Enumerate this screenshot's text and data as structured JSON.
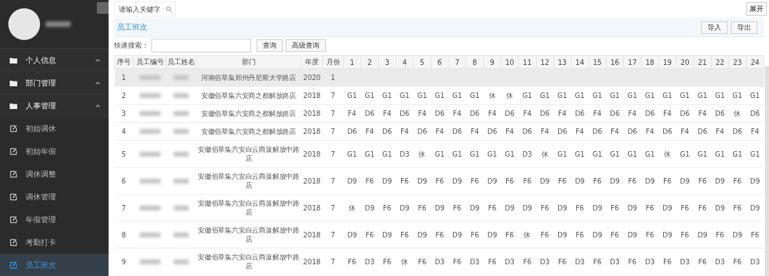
{
  "sidebar": {
    "menu": [
      {
        "label": "个人信息"
      },
      {
        "label": "部门管理"
      },
      {
        "label": "人事管理",
        "children": [
          {
            "label": "初始调休",
            "selected": false
          },
          {
            "label": "初始年假",
            "selected": false
          },
          {
            "label": "调休调整",
            "selected": false
          },
          {
            "label": "调休管理",
            "selected": false
          },
          {
            "label": "年假管理",
            "selected": false
          },
          {
            "label": "考勤打卡",
            "selected": false
          },
          {
            "label": "员工班次",
            "selected": true
          }
        ]
      }
    ]
  },
  "topbar": {
    "search": {
      "placeholder": "请输入关键字"
    },
    "expand_button": "展开"
  },
  "tab": {
    "label": "员工班次"
  },
  "toolbar": {
    "buttons": [
      "导入",
      "导出"
    ]
  },
  "quick_search": {
    "label": "快速搜索：",
    "buttons": [
      "查询",
      "高级查询"
    ]
  },
  "table": {
    "columns": [
      "序号",
      "员工编号",
      "员工姓名",
      "部门",
      "年度",
      "月份",
      "1",
      "2",
      "3",
      "4",
      "5",
      "6",
      "7",
      "8",
      "9",
      "10",
      "11",
      "12",
      "13",
      "14",
      "15",
      "16",
      "17",
      "18",
      "19",
      "20",
      "21",
      "22",
      "23",
      "24"
    ],
    "rows": [
      {
        "index": "1",
        "department": "河南佰草集郑州丹尼斯大学路店",
        "year": "2020",
        "month": "1",
        "selected": true
      },
      {
        "index": "2",
        "department": "安徽佰草集六安商之都解放路店",
        "year": "2018",
        "month": "7",
        "selected": false,
        "shifts": [
          "G1",
          "G1",
          "G1",
          "G1",
          "G1",
          "G1",
          "G1",
          "G1",
          "休",
          "休",
          "G1",
          "G1",
          "G1",
          "G1",
          "G1",
          "G1",
          "G1",
          "G1",
          "G1",
          "G1",
          "G1",
          "G1",
          "G1",
          "G1"
        ]
      },
      {
        "index": "3",
        "department": "安徽佰草集六安商之都解放路店",
        "year": "2018",
        "month": "7",
        "selected": false,
        "shifts": [
          "F4",
          "D6",
          "F4",
          "D6",
          "F4",
          "D6",
          "F4",
          "D6",
          "F4",
          "D6",
          "F4",
          "D6",
          "F4",
          "D6",
          "F4",
          "D6",
          "F4",
          "D6",
          "F4",
          "D6",
          "F4",
          "D6",
          "休",
          "D6"
        ]
      },
      {
        "index": "4",
        "department": "安徽佰草集六安商之都解放路店",
        "year": "2018",
        "month": "7",
        "selected": false,
        "shifts": [
          "D6",
          "F4",
          "D6",
          "F4",
          "D6",
          "F4",
          "D6",
          "F4",
          "D6",
          "F4",
          "D6",
          "F4",
          "D6",
          "F4",
          "D6",
          "F4",
          "D6",
          "F4",
          "D6",
          "F4",
          "D6",
          "F4",
          "D6",
          "F4"
        ]
      },
      {
        "index": "5",
        "department": "安徽佰草集六安白云商厦解放中路店",
        "year": "2018",
        "month": "7",
        "selected": false,
        "shifts": [
          "G1",
          "G1",
          "G1",
          "D3",
          "休",
          "G1",
          "G1",
          "G1",
          "G1",
          "G1",
          "D3",
          "休",
          "G1",
          "G1",
          "G1",
          "G1",
          "G1",
          "G1",
          "休",
          "G1",
          "G1",
          "G1",
          "G1",
          "G1"
        ]
      },
      {
        "index": "6",
        "department": "安徽佰草集六安白云商厦解放中路店",
        "year": "2018",
        "month": "7",
        "selected": false,
        "shifts": [
          "D9",
          "F6",
          "D9",
          "F6",
          "D9",
          "F6",
          "D9",
          "F6",
          "D9",
          "F6",
          "F6",
          "D9",
          "F6",
          "D9",
          "F6",
          "D9",
          "F6",
          "D9",
          "F6",
          "D9",
          "F6",
          "D9",
          "F6",
          "D9"
        ]
      },
      {
        "index": "7",
        "department": "安徽佰草集六安白云商厦解放中路店",
        "year": "2018",
        "month": "7",
        "selected": false,
        "shifts": [
          "休",
          "D9",
          "F6",
          "D9",
          "F6",
          "D9",
          "F6",
          "D9",
          "F6",
          "D9",
          "D9",
          "F6",
          "D9",
          "F6",
          "D9",
          "F6",
          "D9",
          "F6",
          "D9",
          "F6",
          "F6",
          "D9",
          "F6",
          "D9"
        ]
      },
      {
        "index": "8",
        "department": "安徽佰草集六安白云商厦解放中路店",
        "year": "2018",
        "month": "7",
        "selected": false,
        "shifts": [
          "D9",
          "F6",
          "D9",
          "F6",
          "D9",
          "F6",
          "D9",
          "F6",
          "D9",
          "F6",
          "休",
          "F6",
          "D9",
          "F6",
          "D9",
          "F6",
          "D9",
          "F6",
          "D9",
          "F6",
          "D9",
          "F6",
          "D9",
          "F6"
        ]
      },
      {
        "index": "9",
        "department": "安徽佰草集六安白云商厦解放中路店",
        "year": "2018",
        "month": "7",
        "selected": false,
        "shifts": [
          "F6",
          "D3",
          "F6",
          "休",
          "F6",
          "D3",
          "F6",
          "D3",
          "F6",
          "D3",
          "F6",
          "D3",
          "F6",
          "D3",
          "F6",
          "D3",
          "F6",
          "D3",
          "F6",
          "D3",
          "F6",
          "D3",
          "F6",
          "D3"
        ]
      }
    ]
  }
}
